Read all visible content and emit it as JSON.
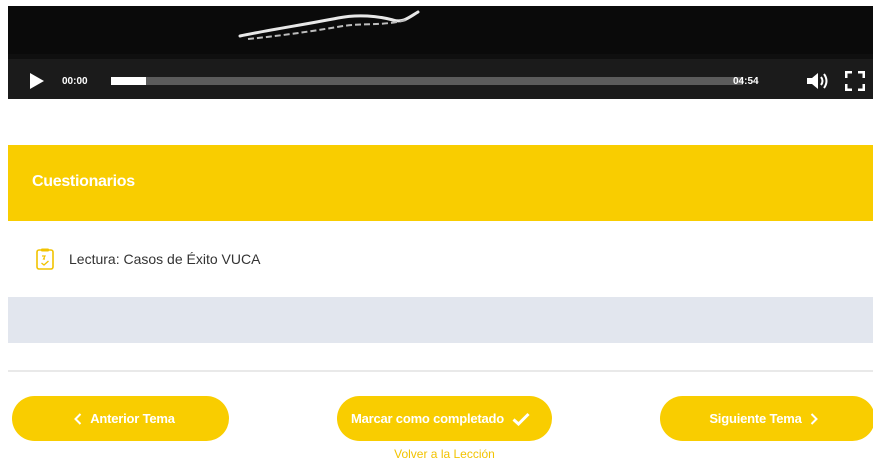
{
  "player": {
    "current_time": "00:00",
    "total_time": "04:54",
    "progress": 0.055
  },
  "quiz": {
    "title": "Cuestionarios",
    "items": [
      {
        "label": "Lectura: Casos de Éxito VUCA",
        "icon": "quiz-document-icon"
      }
    ]
  },
  "navigation": {
    "prev_label": "Anterior Tema",
    "complete_label": "Marcar como completado",
    "next_label": "Siguiente Tema",
    "back_label": "Volver a la Lección"
  },
  "colors": {
    "accent": "#f9cd00",
    "player_bg": "#1b1b1b",
    "panel_bg": "#e2e6ee"
  }
}
